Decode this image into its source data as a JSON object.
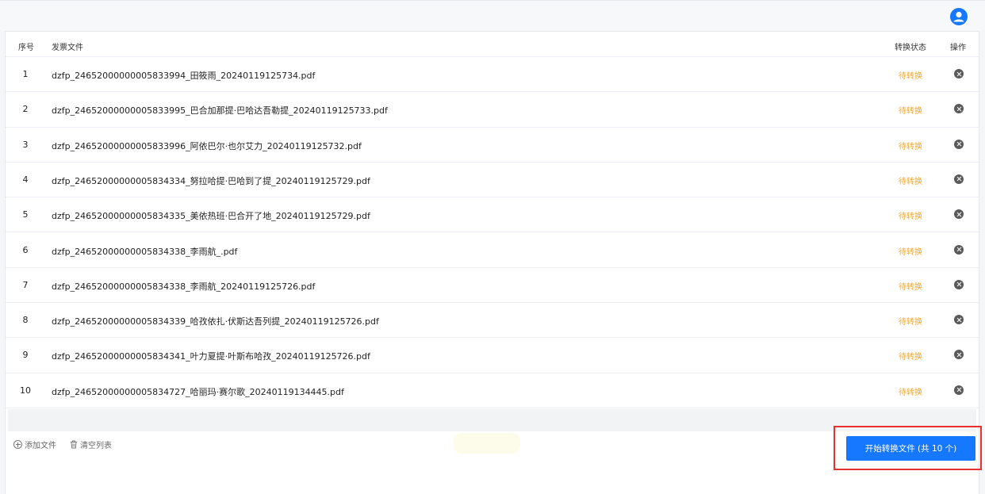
{
  "table": {
    "headers": {
      "index": "序号",
      "file": "发票文件",
      "status": "转换状态",
      "actions": "操作"
    },
    "rows": [
      {
        "index": "1",
        "file": "dzfp_24652000000005833994_田筱雨_20240119125734.pdf",
        "status": "待转换"
      },
      {
        "index": "2",
        "file": "dzfp_24652000000005833995_巴合加那提·巴哈达吾勒提_20240119125733.pdf",
        "status": "待转换"
      },
      {
        "index": "3",
        "file": "dzfp_24652000000005833996_阿依巴尔·也尔艾力_20240119125732.pdf",
        "status": "待转换"
      },
      {
        "index": "4",
        "file": "dzfp_24652000000005834334_努拉哈提·巴哈到了提_20240119125729.pdf",
        "status": "待转换"
      },
      {
        "index": "5",
        "file": "dzfp_24652000000005834335_美依热班·巴合开了地_20240119125729.pdf",
        "status": "待转换"
      },
      {
        "index": "6",
        "file": "dzfp_24652000000005834338_李雨航_.pdf",
        "status": "待转换"
      },
      {
        "index": "7",
        "file": "dzfp_24652000000005834338_李雨航_20240119125726.pdf",
        "status": "待转换"
      },
      {
        "index": "8",
        "file": "dzfp_24652000000005834339_哈孜依扎·伏斯达吾列提_20240119125726.pdf",
        "status": "待转换"
      },
      {
        "index": "9",
        "file": "dzfp_24652000000005834341_叶力夏提·叶斯布哈孜_20240119125726.pdf",
        "status": "待转换"
      },
      {
        "index": "10",
        "file": "dzfp_24652000000005834727_哈丽玛·赛尔歌_20240119134445.pdf",
        "status": "待转换"
      }
    ]
  },
  "footer": {
    "add_file": "添加文件",
    "clear_list": "清空列表",
    "start_button": "开始转换文件 (共 10 个)"
  },
  "icons": {
    "avatar": "user-icon",
    "delete": "close-circle-icon",
    "add": "plus-circle-icon",
    "clear": "trash-icon"
  },
  "colors": {
    "primary": "#1677ff",
    "pending_status": "#f5a623",
    "highlight_border": "#e8312f"
  }
}
